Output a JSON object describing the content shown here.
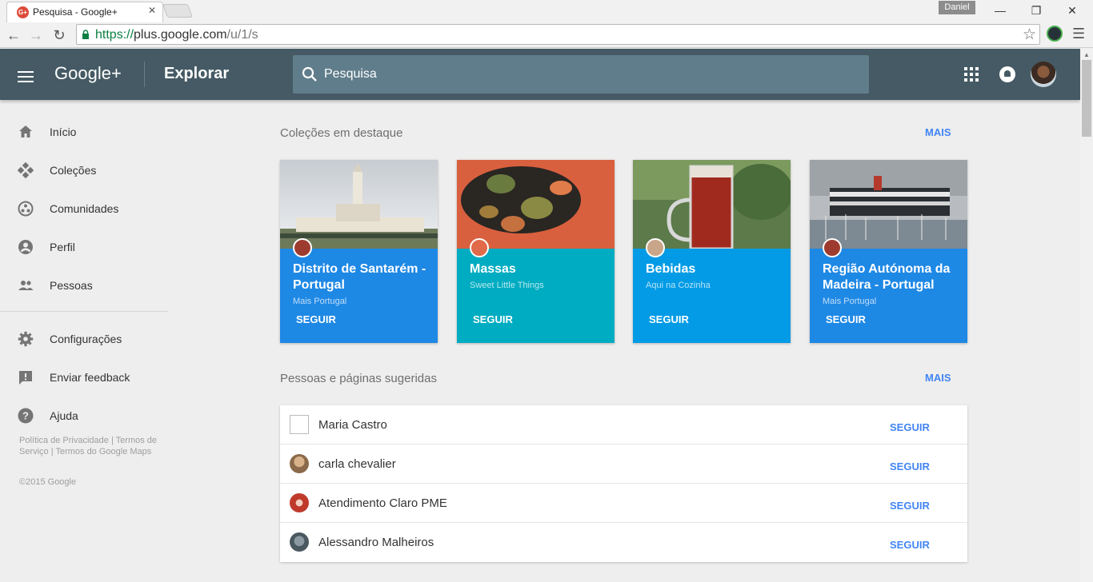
{
  "browser": {
    "tab_title": "Pesquisa - Google+",
    "tab_close": "✕",
    "favicon_text": "G+",
    "profile_name": "Daniel",
    "window_controls": {
      "minimize": "—",
      "restore": "❐",
      "close": "✕"
    },
    "url_scheme": "https://",
    "url_host": "plus.google.com",
    "url_path": "/u/1/s",
    "nav": {
      "back": "←",
      "forward": "→",
      "reload": "↻"
    },
    "star": "☆",
    "menu": "☰"
  },
  "appbar": {
    "logo": "Google+",
    "section": "Explorar",
    "search_placeholder": "Pesquisa"
  },
  "sidebar": {
    "items": [
      {
        "label": "Início",
        "icon": "home-icon"
      },
      {
        "label": "Coleções",
        "icon": "collections-icon"
      },
      {
        "label": "Comunidades",
        "icon": "communities-icon"
      },
      {
        "label": "Perfil",
        "icon": "profile-icon"
      },
      {
        "label": "Pessoas",
        "icon": "people-icon"
      },
      {
        "label": "Configurações",
        "icon": "settings-icon"
      },
      {
        "label": "Enviar feedback",
        "icon": "feedback-icon"
      },
      {
        "label": "Ajuda",
        "icon": "help-icon"
      }
    ],
    "footer_links": "Política de Privacidade | Termos de Serviço | Termos do Google Maps",
    "copyright": "©2015 Google"
  },
  "collections": {
    "heading": "Coleções em destaque",
    "more": "MAIS",
    "cards": [
      {
        "title": "Distrito de Santarém - Portugal",
        "subtitle": "Mais Portugal",
        "follow": "SEGUIR",
        "color": "#1e88e5"
      },
      {
        "title": "Massas",
        "subtitle": "Sweet Little Things",
        "follow": "SEGUIR",
        "color": "#00acc1"
      },
      {
        "title": "Bebidas",
        "subtitle": "Aqui na Cozinha",
        "follow": "SEGUIR",
        "color": "#039be5"
      },
      {
        "title": "Região Autónoma da Madeira - Portugal",
        "subtitle": "Mais Portugal",
        "follow": "SEGUIR",
        "color": "#1e88e5"
      }
    ]
  },
  "people": {
    "heading": "Pessoas e páginas sugeridas",
    "more": "MAIS",
    "rows": [
      {
        "name": "Maria Castro",
        "follow": "SEGUIR"
      },
      {
        "name": "carla chevalier",
        "follow": "SEGUIR"
      },
      {
        "name": "Atendimento Claro PME",
        "follow": "SEGUIR"
      },
      {
        "name": "Alessandro Malheiros",
        "follow": "SEGUIR"
      }
    ]
  }
}
